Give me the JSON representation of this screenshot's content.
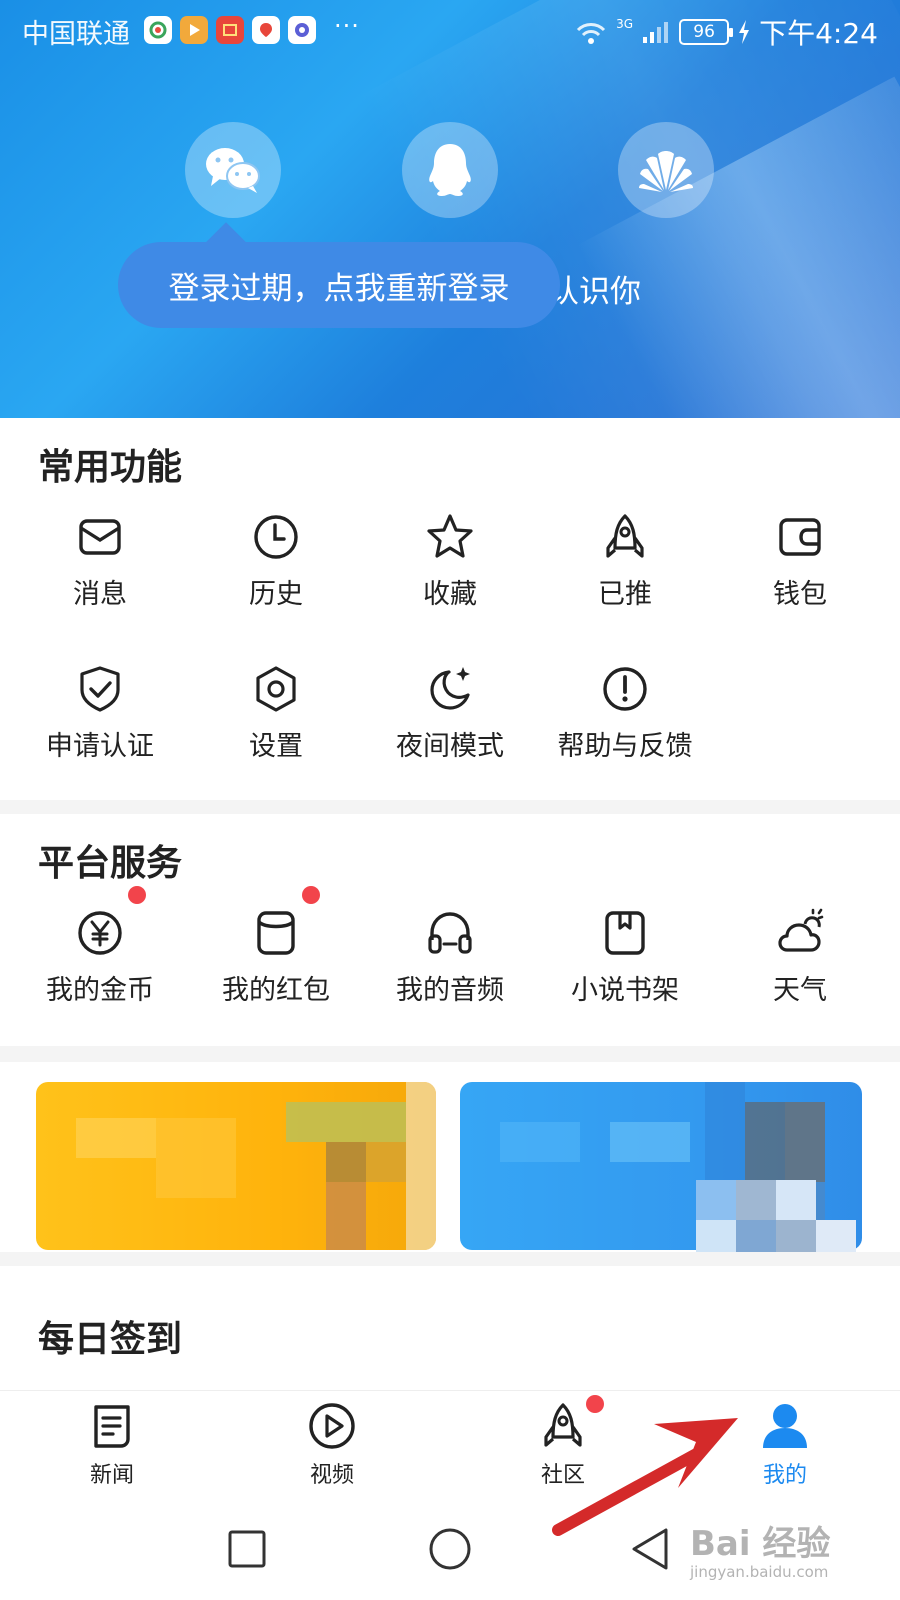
{
  "status_bar": {
    "carrier": "中国联通",
    "network": "3G",
    "battery": "96",
    "time": "下午4:24",
    "more": "···"
  },
  "header": {
    "login_options": [
      {
        "icon": "wechat-icon"
      },
      {
        "icon": "qq-icon"
      },
      {
        "icon": "huawei-icon"
      }
    ],
    "tooltip": "登录过期，点我重新登录",
    "subtitle_visible": "认识你"
  },
  "common_functions": {
    "title": "常用功能",
    "items": [
      {
        "label": "消息",
        "icon": "message-icon"
      },
      {
        "label": "历史",
        "icon": "clock-icon"
      },
      {
        "label": "收藏",
        "icon": "star-icon"
      },
      {
        "label": "已推",
        "icon": "rocket-icon"
      },
      {
        "label": "钱包",
        "icon": "wallet-icon"
      },
      {
        "label": "申请认证",
        "icon": "shield-check-icon"
      },
      {
        "label": "设置",
        "icon": "settings-icon"
      },
      {
        "label": "夜间模式",
        "icon": "moon-icon"
      },
      {
        "label": "帮助与反馈",
        "icon": "help-icon"
      }
    ]
  },
  "platform_services": {
    "title": "平台服务",
    "items": [
      {
        "label": "我的金币",
        "icon": "coin-icon",
        "badge": true
      },
      {
        "label": "我的红包",
        "icon": "red-packet-icon",
        "badge": true
      },
      {
        "label": "我的音频",
        "icon": "headphones-icon",
        "badge": false
      },
      {
        "label": "小说书架",
        "icon": "bookshelf-icon",
        "badge": false
      },
      {
        "label": "天气",
        "icon": "weather-icon",
        "badge": false
      }
    ]
  },
  "daily_checkin": {
    "title": "每日签到"
  },
  "bottom_nav": {
    "items": [
      {
        "label": "新闻",
        "icon": "news-icon",
        "active": false
      },
      {
        "label": "视频",
        "icon": "video-icon",
        "active": false
      },
      {
        "label": "社区",
        "icon": "community-icon",
        "active": false,
        "badge": true
      },
      {
        "label": "我的",
        "icon": "profile-icon",
        "active": true
      }
    ]
  },
  "watermark": {
    "brand": "Bai 经验",
    "url": "jingyan.baidu.com"
  },
  "colors": {
    "header_blue": "#1e8fe8",
    "accent_blue": "#1c8af0",
    "badge_red": "#f2444b",
    "arrow_red": "#d42a2a"
  }
}
